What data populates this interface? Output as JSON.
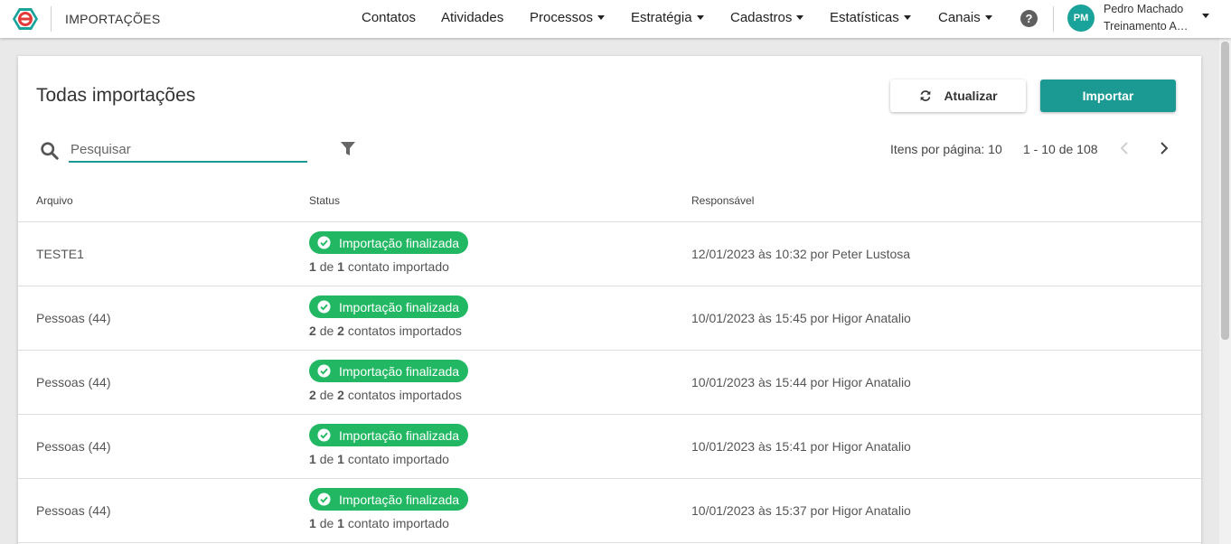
{
  "header": {
    "app_title": "IMPORTAÇÕES",
    "nav": [
      {
        "label": "Contatos",
        "dropdown": false
      },
      {
        "label": "Atividades",
        "dropdown": false
      },
      {
        "label": "Processos",
        "dropdown": true
      },
      {
        "label": "Estratégia",
        "dropdown": true
      },
      {
        "label": "Cadastros",
        "dropdown": true
      },
      {
        "label": "Estatísticas",
        "dropdown": true
      },
      {
        "label": "Canais",
        "dropdown": true
      }
    ],
    "help_icon": "?",
    "user": {
      "initials": "PM",
      "name": "Pedro Machado",
      "org": "Treinamento Atendimento"
    }
  },
  "main": {
    "title": "Todas importações",
    "refresh_label": "Atualizar",
    "import_label": "Importar",
    "search_placeholder": "Pesquisar",
    "per_page": "Itens por página: 10",
    "range": "1 - 10 de 108",
    "columns": {
      "file": "Arquivo",
      "status": "Status",
      "responsible": "Responsável"
    },
    "rows": [
      {
        "file": "TESTE1",
        "status": "Importação finalizada",
        "imported": "1",
        "of_word": "de",
        "total": "1",
        "suffix": "contato importado",
        "responsible": "12/01/2023 às 10:32 por Peter Lustosa"
      },
      {
        "file": "Pessoas (44)",
        "status": "Importação finalizada",
        "imported": "2",
        "of_word": "de",
        "total": "2",
        "suffix": "contatos importados",
        "responsible": "10/01/2023 às 15:45 por Higor Anatalio"
      },
      {
        "file": "Pessoas (44)",
        "status": "Importação finalizada",
        "imported": "2",
        "of_word": "de",
        "total": "2",
        "suffix": "contatos importados",
        "responsible": "10/01/2023 às 15:44 por Higor Anatalio"
      },
      {
        "file": "Pessoas (44)",
        "status": "Importação finalizada",
        "imported": "1",
        "of_word": "de",
        "total": "1",
        "suffix": "contato importado",
        "responsible": "10/01/2023 às 15:41 por Higor Anatalio"
      },
      {
        "file": "Pessoas (44)",
        "status": "Importação finalizada",
        "imported": "1",
        "of_word": "de",
        "total": "1",
        "suffix": "contato importado",
        "responsible": "10/01/2023 às 15:37 por Higor Anatalio"
      }
    ]
  },
  "icons": {
    "logo": "app-logo-icon",
    "refresh": "refresh-icon",
    "search": "search-icon",
    "filter": "filter-icon",
    "prev": "chevron-left-icon",
    "next": "chevron-right-icon",
    "status": "check-circle-icon"
  },
  "colors": {
    "accent": "#1a9a93",
    "status_success": "#22b863",
    "logo_red": "#e23a3a",
    "logo_teal": "#1aa39a"
  }
}
